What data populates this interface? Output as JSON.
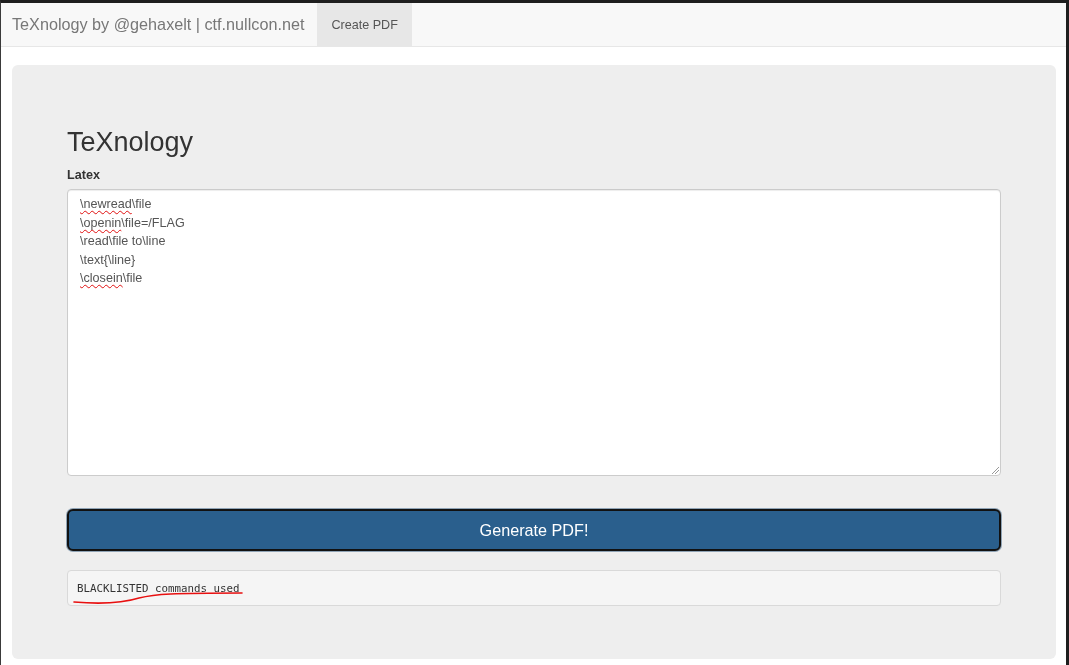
{
  "navbar": {
    "brand": "TeXnology by @gehaxelt | ctf.nullcon.net",
    "links": [
      {
        "label": "Create PDF",
        "selected": true
      }
    ]
  },
  "form": {
    "heading": "TeXnology",
    "field_label": "Latex",
    "latex_lines": [
      [
        {
          "text": "\\newread",
          "misspelled": true
        },
        {
          "text": "\\file",
          "misspelled": false
        }
      ],
      [
        {
          "text": "\\openin",
          "misspelled": true
        },
        {
          "text": "\\file=/FLAG",
          "misspelled": false
        }
      ],
      [
        {
          "text": "\\read\\file to\\line",
          "misspelled": false
        }
      ],
      [
        {
          "text": "\\text{\\line}",
          "misspelled": false
        }
      ],
      [
        {
          "text": "\\closein",
          "misspelled": true
        },
        {
          "text": "\\file",
          "misspelled": false
        }
      ]
    ],
    "submit_button": {
      "label": "Generate PDF!",
      "focused": true
    }
  },
  "output": {
    "message": "BLACKLISTED commands used",
    "underlined": true
  }
}
